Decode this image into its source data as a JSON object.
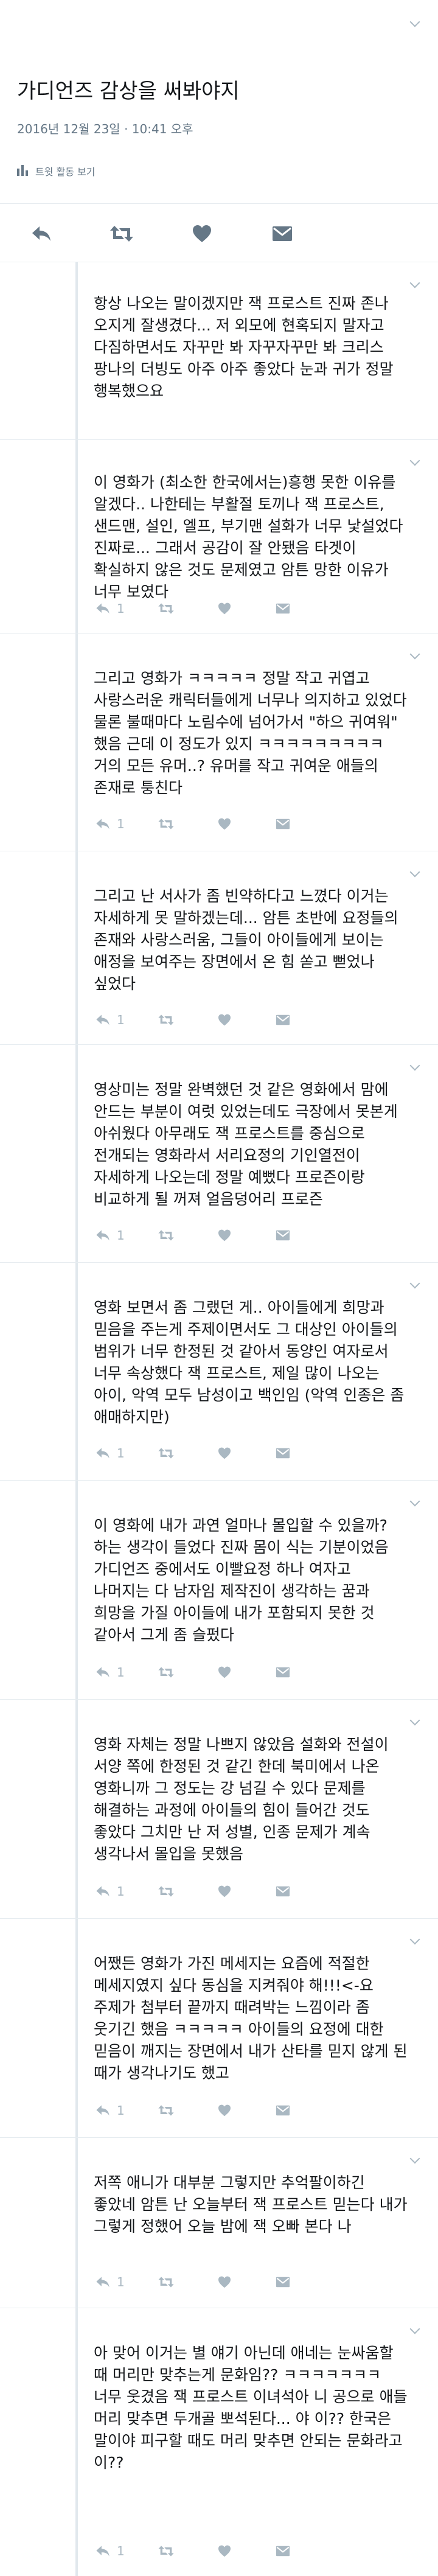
{
  "header": {
    "title": "가디언즈 감상을 써봐야지",
    "date": "2016년 12월 23일 · 10:41 오후",
    "activity_label": "트윗 활동 보기"
  },
  "action_bar": {
    "icons": [
      "reply-icon",
      "retweet-icon",
      "like-icon",
      "message-icon"
    ]
  },
  "tweets": [
    {
      "text": "항상 나오는 말이겠지만 잭 프로스트 진짜 존나 오지게 잘생겼다... 저 외모에 현혹되지 말자고 다짐하면서도 자꾸만 봐 자꾸자꾸만 봐 크리스 팡나의 더빙도 아주 아주 좋았다 눈과 귀가 정말 행복했으요",
      "reply_count": ""
    },
    {
      "text": "이 영화가 (최소한 한국에서는)흥행 못한 이유를 알겠다.. 나한테는 부활절 토끼나 잭 프로스트, 샌드맨, 설인, 엘프, 부기맨 설화가 너무 낯설었다 진짜로... 그래서 공감이 잘 안됐음 타겟이 확실하지 않은 것도 문제였고 암튼 망한 이유가 너무 보였다",
      "reply_count": "1"
    },
    {
      "text": "그리고 영화가 ㅋㅋㅋㅋㅋ 정말 작고 귀엽고 사랑스러운 캐릭터들에게 너무나 의지하고 있었다 물론 불때마다 노림수에 넘어가서 \"하으 귀여워\" 했음 근데 이 정도가 있지 ㅋㅋㅋㅋㅋㅋㅋㅋㅋ 거의 모든 유머..? 유머를 작고 귀여운 애들의 존재로 퉁친다",
      "reply_count": "1"
    },
    {
      "text": "그리고 난 서사가 좀 빈약하다고 느꼈다 이거는 자세하게 못 말하겠는데... 암튼 초반에 요정들의 존재와 사랑스러움, 그들이 아이들에게 보이는 애정을 보여주는 장면에서 온 힘 쏟고 뻗었나 싶었다",
      "reply_count": "1"
    },
    {
      "text": "영상미는 정말 완벽했던 것 같은 영화에서 맘에 안드는 부분이 여럿 있었는데도 극장에서 못본게 아쉬웠다 아무래도 잭 프로스트를 중심으로 전개되는 영화라서 서리요정의 기인열전이 자세하게 나오는데 정말 예뻤다 프로즌이랑 비교하게 될 꺼져 얼음덩어리 프로즌",
      "reply_count": "1"
    },
    {
      "text": "영화 보면서 좀 그랬던 게.. 아이들에게 희망과 믿음을 주는게 주제이면서도 그 대상인 아이들의 범위가 너무 한정된 것 같아서 동양인 여자로서 너무 속상했다 잭 프로스트, 제일 많이 나오는 아이, 악역 모두 남성이고 백인임 (악역 인종은 좀 애매하지만)",
      "reply_count": "1"
    },
    {
      "text": "이 영화에 내가 과연 얼마나 몰입할 수 있을까? 하는 생각이 들었다 진짜 몸이 식는 기분이었음 가디언즈 중에서도 이빨요정 하나 여자고 나머지는 다 남자임 제작진이 생각하는 꿈과 희망을 가질 아이들에 내가 포함되지 못한 것 같아서 그게 좀 슬펐다",
      "reply_count": "1"
    },
    {
      "text": "영화 자체는 정말 나쁘지 않았음 설화와 전설이 서양 쪽에 한정된 것 같긴 한데 북미에서 나온 영화니까 그 정도는 강 넘길 수 있다 문제를 해결하는 과정에 아이들의 힘이 들어간 것도 좋았다 그치만 난 저 성별, 인종 문제가 계속 생각나서 몰입을 못했음",
      "reply_count": "1"
    },
    {
      "text": "어쨌든 영화가 가진 메세지는 요즘에 적절한 메세지였지 싶다 동심을 지켜줘야 해!!!<-요 주제가 첨부터 끝까지 때려박는 느낌이라 좀 웃기긴 했음 ㅋㅋㅋㅋㅋ 아이들의 요정에 대한 믿음이 깨지는 장면에서 내가 산타를 믿지 않게 된 때가 생각나기도 했고",
      "reply_count": "1"
    },
    {
      "text": "저쪽 애니가 대부분 그렇지만 추억팔이하긴 좋았네 암튼 난 오늘부터 잭 프로스트 믿는다 내가 그렇게 정했어 오늘 밤에 잭 오빠 본다 나",
      "reply_count": "1"
    },
    {
      "text": "아 맞어 이거는 별 얘기 아닌데 애네는 눈싸움할 때 머리만 맞추는게 문화임?? ㅋㅋㅋㅋㅋㅋㅋ 너무 웃겼음 잭 프로스트 이녀석아 니 공으로 애들 머리 맞추면 두개골 뽀석된다... 야 이?? 한국은 말이야 피구할 때도 머리 맞추면 안되는 문화라고 이??",
      "reply_count": "1"
    }
  ]
}
